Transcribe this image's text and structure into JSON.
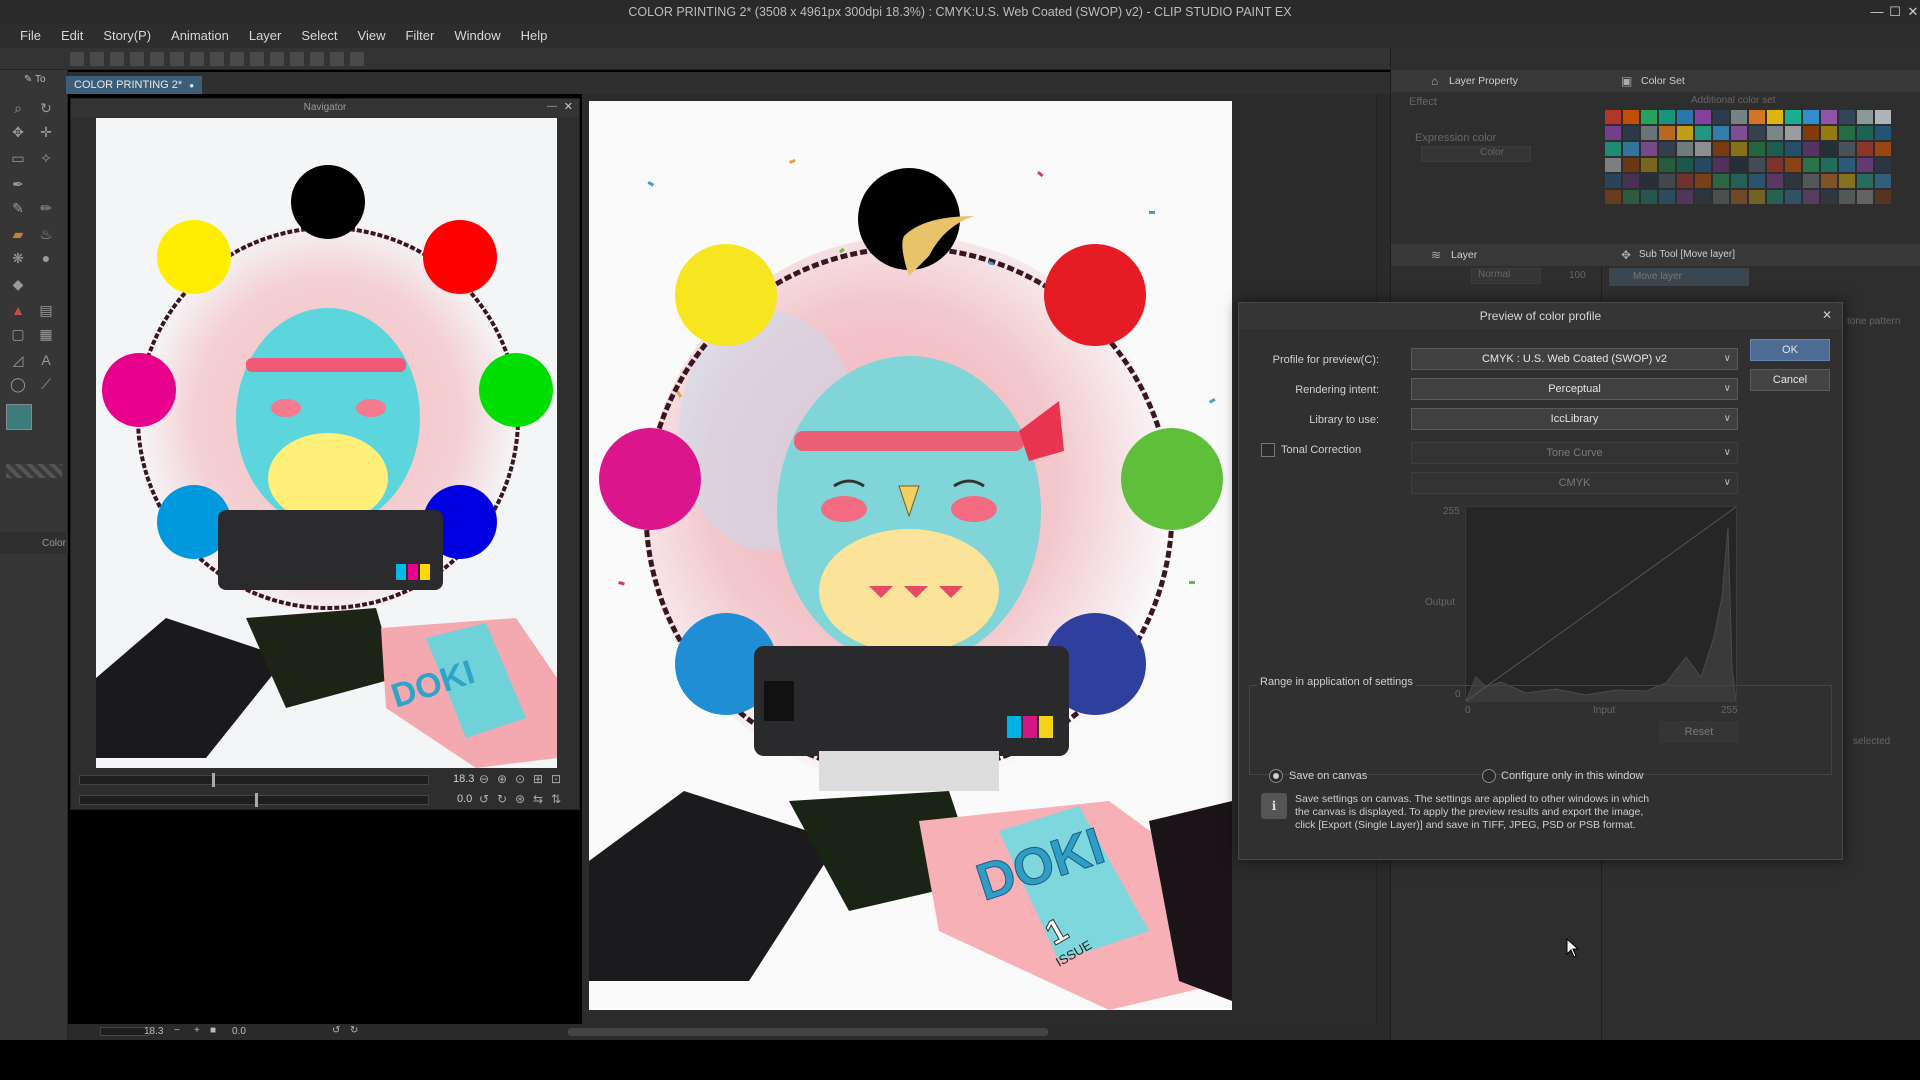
{
  "window": {
    "title": "COLOR PRINTING 2* (3508 x 4961px 300dpi 18.3%) : CMYK:U.S. Web Coated (SWOP) v2) - CLIP STUDIO PAINT EX",
    "minimize": "—",
    "maximize": "☐",
    "close": "✕"
  },
  "menu": [
    "File",
    "Edit",
    "Story(P)",
    "Animation",
    "Layer",
    "Select",
    "View",
    "Filter",
    "Window",
    "Help"
  ],
  "tools_panel": {
    "tab_label": "To",
    "color_label": "Color"
  },
  "document_tab": {
    "label": "COLOR PRINTING 2*",
    "close": "●"
  },
  "navigator": {
    "title": "Navigator",
    "zoom_value": "18.3",
    "rotate_value": "0.0"
  },
  "artwork": {
    "ring_colors": [
      "#000000",
      "#ffee00",
      "#ff0000",
      "#e6008c",
      "#00dd00",
      "#0099dd",
      "#0000e0"
    ],
    "canvas_ring_colors": [
      "#000000",
      "#f6e51f",
      "#e61c24",
      "#db168d",
      "#5fbf3a",
      "#1f8ed4",
      "#2f3f9e"
    ],
    "doki_text": "DOKI",
    "issue_text": "ISSUE",
    "issue_number": "1"
  },
  "right_panels": {
    "layer_property": {
      "title": "Layer Property",
      "effect_label": "Effect",
      "expression_color_label": "Expression color",
      "expression_color_value": "Color"
    },
    "color_set": {
      "title": "Color Set",
      "set_name": "Additional color set"
    },
    "layer": {
      "title": "Layer",
      "blend_mode": "Normal",
      "opacity": "100"
    },
    "sub_tool": {
      "title": "Sub Tool [Move layer]",
      "item": "Move layer",
      "tone_pattern": "tone pattern",
      "selected": "selected"
    }
  },
  "dialog": {
    "title": "Preview of color profile",
    "close": "✕",
    "profile_label": "Profile for preview(C):",
    "profile_value": "CMYK : U.S. Web Coated (SWOP) v2",
    "intent_label": "Rendering intent:",
    "intent_value": "Perceptual",
    "library_label": "Library to use:",
    "library_value": "IccLibrary",
    "tonal_correction_label": "Tonal Correction",
    "tone_curve_value": "Tone Curve",
    "channel_value": "CMYK",
    "graph": {
      "y_max": "255",
      "y_min": "0",
      "y_label": "Output",
      "x_min": "0",
      "x_label": "Input",
      "x_max": "255"
    },
    "reset_label": "Reset",
    "ok_label": "OK",
    "cancel_label": "Cancel",
    "range_group_label": "Range in application of settings",
    "save_on_canvas_label": "Save on canvas",
    "configure_only_label": "Configure only in this window",
    "info_icon": "i",
    "info_text_1": "Save settings on canvas. The settings are applied to other windows in which",
    "info_text_2": "the canvas is displayed. To apply the preview results and export the image,",
    "info_text_3": "click [Export (Single Layer)] and save in TIFF, JPEG, PSD or PSB format."
  },
  "bottom_bar": {
    "zoom": "18.3",
    "rotation": "0.0"
  }
}
